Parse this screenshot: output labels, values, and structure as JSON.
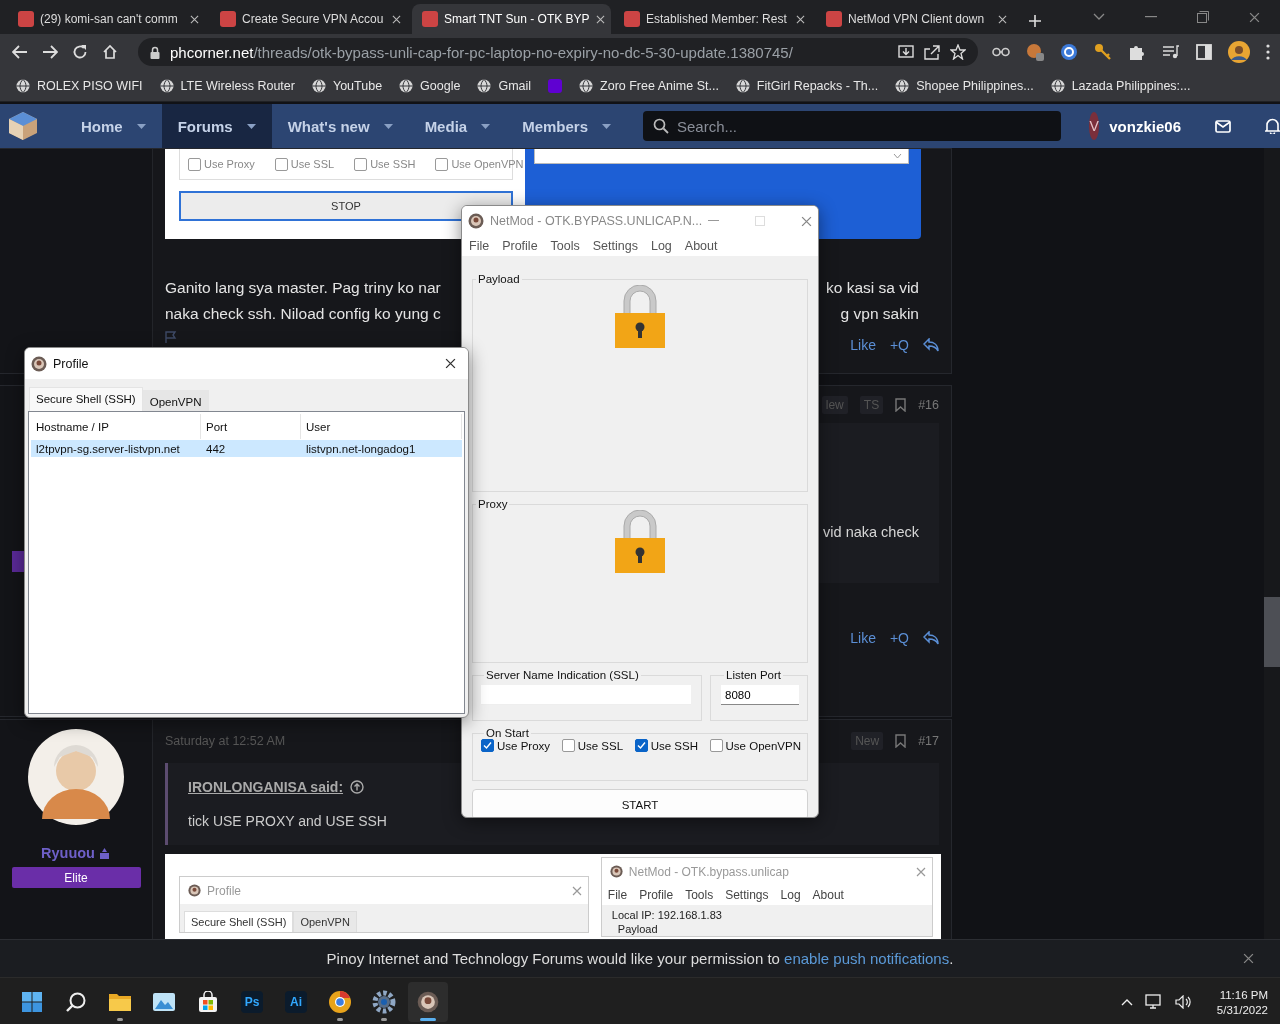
{
  "browser": {
    "tabs": [
      {
        "title": "(29) komi-san can't comm",
        "selected": false
      },
      {
        "title": "Create Secure VPN Accou",
        "selected": false
      },
      {
        "title": "Smart TNT Sun - OTK BYP",
        "selected": true
      },
      {
        "title": "Established Member: Rest",
        "selected": false
      },
      {
        "title": "NetMod VPN Client down",
        "selected": false
      }
    ],
    "address": {
      "domain": "phcorner.net",
      "path": "/threads/otk-bypass-unli-cap-for-pc-laptop-no-expiry-no-dc-5-30-update.1380745/"
    },
    "bookmarks": [
      {
        "label": "ROLEX PISO WIFI"
      },
      {
        "label": "LTE Wireless Router"
      },
      {
        "label": "YouTube"
      },
      {
        "label": "Google"
      },
      {
        "label": "Gmail"
      },
      {
        "kind": "icon"
      },
      {
        "label": "Zoro Free Anime St..."
      },
      {
        "label": "FitGirl Repacks - Th..."
      },
      {
        "label": "Shopee Philippines..."
      },
      {
        "label": "Lazada Philippines:..."
      }
    ]
  },
  "forum": {
    "nav": [
      {
        "label": "Home",
        "selected": false
      },
      {
        "label": "Forums",
        "selected": true
      },
      {
        "label": "What's new",
        "selected": false
      },
      {
        "label": "Media",
        "selected": false
      },
      {
        "label": "Members",
        "selected": false
      }
    ],
    "search": {
      "placeholder": "Search..."
    },
    "user": {
      "initial": "V",
      "name": "vonzkie06"
    },
    "post_1": {
      "embedded_options": [
        {
          "label": "Use Proxy",
          "checked": false
        },
        {
          "label": "Use SSL",
          "checked": false
        },
        {
          "label": "Use SSH",
          "checked": false
        },
        {
          "label": "Use OpenVPN",
          "checked": false
        }
      ],
      "embedded_button": "STOP",
      "text_left": [
        "Ganito lang sya master. Pag triny ko nar",
        "naka check ssh. Niload config ko yung c"
      ],
      "text_right": [
        "ko kasi sa vid",
        "g vpn sakin"
      ],
      "actions": [
        "Like",
        "+Q"
      ]
    },
    "post_2": {
      "badges": [
        "lew",
        "TS"
      ],
      "number": "#16",
      "quote_text": "vid naka check",
      "actions": [
        "Like",
        "+Q"
      ]
    },
    "post_3": {
      "user": {
        "name": "Ryuuou",
        "rank": "Elite"
      },
      "date": "Saturday at 12:52 AM",
      "badge": "New",
      "number": "#17",
      "quote": {
        "author": "IRONLONGANISA said:",
        "text": "tick USE PROXY and USE SSH"
      },
      "screenshot": {
        "profile": {
          "title": "Profile",
          "tabs": [
            {
              "label": "Secure Shell (SSH)",
              "selected": true
            },
            {
              "label": "OpenVPN",
              "selected": false
            }
          ]
        },
        "netmod": {
          "title": "NetMod - OTK.bypass.unlicap",
          "menu": [
            "File",
            "Profile",
            "Tools",
            "Settings",
            "Log",
            "About"
          ],
          "local_ip": "Local IP: 192.168.1.83",
          "payload_label": "Payload"
        }
      }
    }
  },
  "netmod_window": {
    "title": "NetMod - OTK.BYPASS.UNLICAP.N...",
    "menu": [
      "File",
      "Profile",
      "Tools",
      "Settings",
      "Log",
      "About"
    ],
    "payload_label": "Payload",
    "proxy_label": "Proxy",
    "sni": {
      "label": "Server Name Indication (SSL)"
    },
    "listen_port": {
      "label": "Listen Port",
      "value": "8080"
    },
    "on_start": {
      "label": "On Start",
      "options": [
        {
          "label": "Use Proxy",
          "checked": true
        },
        {
          "label": "Use SSL",
          "checked": false
        },
        {
          "label": "Use SSH",
          "checked": true
        },
        {
          "label": "Use OpenVPN",
          "checked": false
        }
      ]
    },
    "start_button": "START"
  },
  "profile_window": {
    "title": "Profile",
    "tabs": [
      {
        "label": "Secure Shell (SSH)",
        "selected": true
      },
      {
        "label": "OpenVPN",
        "selected": false
      }
    ],
    "columns": [
      "Hostname / IP",
      "Port",
      "User"
    ],
    "rows": [
      {
        "cells": [
          "l2tpvpn-sg.server-listvpn.net",
          "442",
          "listvpn.net-longadog1"
        ],
        "selected": true
      }
    ]
  },
  "notification": {
    "text": "Pinoy Internet and Technology Forums would like your permission to ",
    "link": "enable push notifications",
    "after": "."
  },
  "taskbar": {
    "apps": [
      {
        "kind": "start",
        "running": false,
        "active": false
      },
      {
        "kind": "search",
        "running": false,
        "active": false
      },
      {
        "kind": "folder",
        "running": true,
        "active": false
      },
      {
        "kind": "photos",
        "running": false,
        "active": false
      },
      {
        "kind": "store",
        "running": false,
        "active": false
      },
      {
        "kind": "text",
        "label": "Ps",
        "running": false,
        "active": false
      },
      {
        "kind": "text",
        "label": "Ai",
        "running": false,
        "active": false
      },
      {
        "kind": "browser",
        "running": true,
        "active": false
      },
      {
        "kind": "gear",
        "running": true,
        "active": false
      },
      {
        "kind": "app",
        "running": true,
        "active": true
      }
    ],
    "clock": {
      "time": "11:16 PM",
      "date": "5/31/2022"
    }
  }
}
